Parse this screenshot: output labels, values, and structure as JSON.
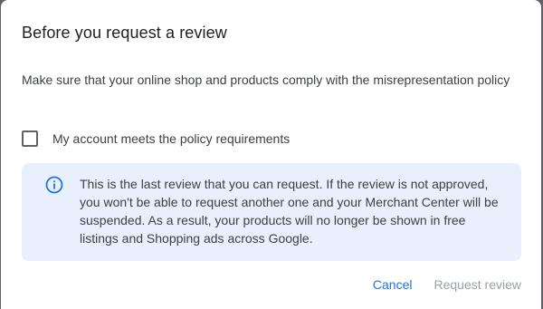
{
  "dialog": {
    "title": "Before you request a review",
    "description": "Make sure that your online shop and products comply with the misrepresentation policy",
    "checkbox": {
      "label": "My account meets the policy requirements",
      "checked": false
    },
    "info": {
      "icon": "info-icon",
      "text": "This is the last review that you can request. If the review is not approved, you won't be able to request another one and your Merchant Center will be suspended. As a result, your products will no longer be shown in free listings and Shopping ads across Google."
    },
    "actions": {
      "cancel_label": "Cancel",
      "request_label": "Request review",
      "request_enabled": false
    }
  },
  "colors": {
    "accent": "#1a73e8",
    "info_bg": "#e8f0fe",
    "disabled": "#9aa0a6",
    "title": "#202124",
    "body": "#3c4043"
  }
}
